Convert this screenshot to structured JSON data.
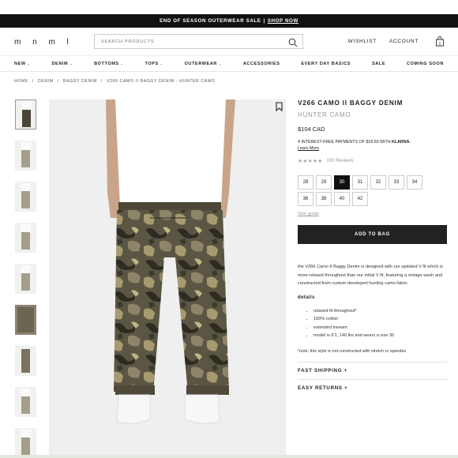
{
  "promo": {
    "text": "END OF SEASON OUTERWEAR SALE",
    "separator": "|",
    "link": "SHOP NOW"
  },
  "header": {
    "logo": "m n m l",
    "search_placeholder": "SEARCH PRODUCTS",
    "wishlist": "WISHLIST",
    "account": "ACCOUNT",
    "bag_count": "0"
  },
  "nav": [
    {
      "label": "NEW",
      "chevron": "⌄"
    },
    {
      "label": "DENIM",
      "chevron": "⌄"
    },
    {
      "label": "BOTTOMS",
      "chevron": "⌄"
    },
    {
      "label": "TOPS",
      "chevron": "⌄"
    },
    {
      "label": "OUTERWEAR",
      "chevron": "⌄"
    },
    {
      "label": "ACCESSORIES",
      "chevron": ""
    },
    {
      "label": "EVERY DAY BASICS",
      "chevron": ""
    },
    {
      "label": "SALE",
      "chevron": ""
    },
    {
      "label": "COMING SOON",
      "chevron": ""
    }
  ],
  "breadcrumb": [
    "HOME",
    "DENIM",
    "BAGGY DENIM",
    "V266 CAMO II BAGGY DENIM - HUNTER CAMO"
  ],
  "product": {
    "title": "V266 CAMO II BAGGY DENIM",
    "color": "HUNTER CAMO",
    "price": "$104 CAD",
    "klarna_text": "4 INTEREST-FREE PAYMENTS OF $18.50 WITH",
    "klarna_brand": "KLARNA.",
    "learn_more": "Learn More",
    "stars": "★★★★★",
    "rating_value": 4.5,
    "reviews": "190 Reviews",
    "sizes": [
      "28",
      "29",
      "30",
      "31",
      "32",
      "33",
      "34",
      "36",
      "38",
      "40",
      "42"
    ],
    "selected_size": "30",
    "size_guide": "Size guide",
    "add_to_bag": "ADD TO BAG",
    "description": "the V266 Camo II Baggy Denim is designed with our updated V fit which is more relaxed throughout than our initial V fit, featuring a vintage wash and constructed from custom developed hunting camo fabric.",
    "details_heading": "details",
    "details": [
      "relaxed fit throughout*",
      "100% cotton",
      "extended inseam",
      "model is 6'1, 140 lbs and wears a size 30"
    ],
    "note": "*note: this style is not constructed with stretch or spandex",
    "fast_shipping": "FAST SHIPPING +",
    "easy_returns": "EASY RETURNS +"
  },
  "colors": {
    "accent": "#222222",
    "camo_dark": "#4a4636",
    "camo_light": "#a59e8a",
    "muted": "#999999"
  }
}
